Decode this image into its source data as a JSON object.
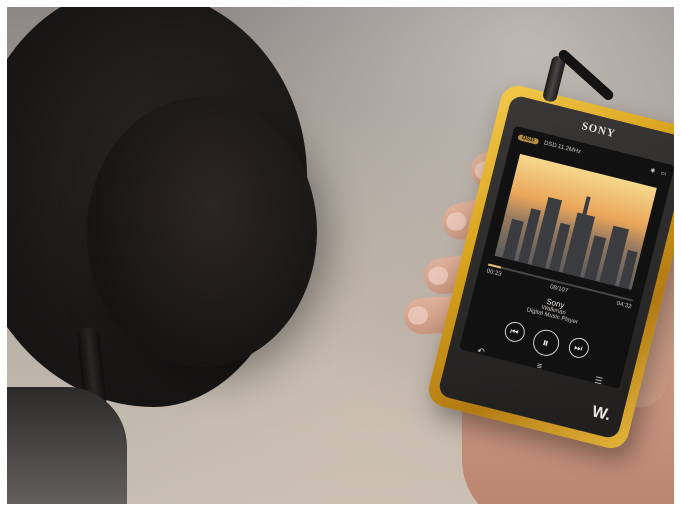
{
  "scene": {
    "device": {
      "brand_logo": "SONY",
      "screen": {
        "status_badge": "DSD",
        "status_text": "DSD 11.2MHz",
        "track_title": "Sony",
        "track_subtitle_1": "Walkman",
        "track_subtitle_2": "Digital Music Player",
        "elapsed_time": "00:23",
        "total_time": "04:32",
        "track_index": "08/107",
        "progress_fraction": 0.09
      },
      "walkman_logo": "W."
    }
  },
  "icons": {
    "prev": "previous-track-icon",
    "pause": "pause-icon",
    "next": "next-track-icon",
    "back": "back-icon",
    "playlist": "playlist-icon",
    "menu": "menu-icon",
    "bluetooth": "bluetooth-icon",
    "battery": "battery-icon"
  },
  "colors": {
    "device_gold": "#D8A21D",
    "screen_bg": "#111111",
    "accent": "#E7C06A"
  }
}
